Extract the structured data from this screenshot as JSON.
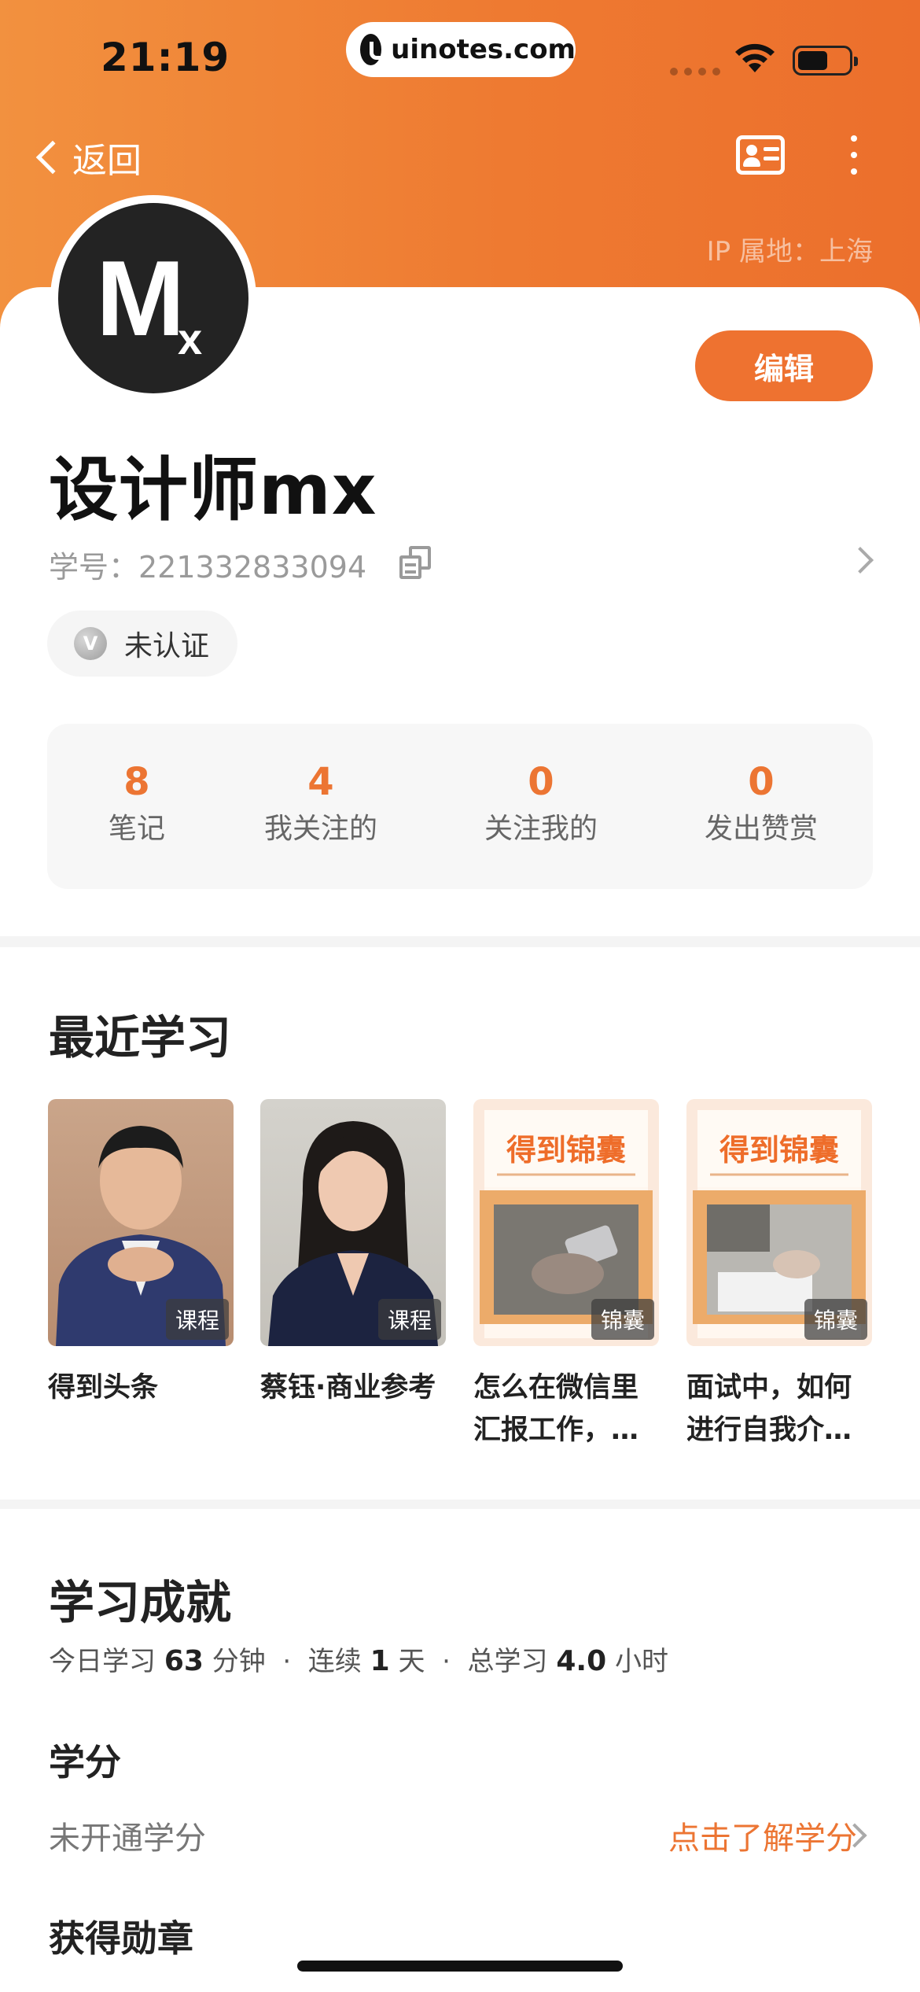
{
  "status_bar": {
    "time": "21:19",
    "url": "uinotes.com"
  },
  "nav": {
    "back_label": "返回",
    "ip_location": "IP 属地：上海"
  },
  "profile": {
    "avatar_letters": "M",
    "avatar_sub": "x",
    "edit_label": "编辑",
    "name": "设计师mx",
    "student_id": "学号：221332833094",
    "verify_icon": "V",
    "verify_label": "未认证"
  },
  "stats": [
    {
      "value": "8",
      "label": "笔记"
    },
    {
      "value": "4",
      "label": "我关注的"
    },
    {
      "value": "0",
      "label": "关注我的"
    },
    {
      "value": "0",
      "label": "发出赞赏"
    }
  ],
  "recent": {
    "title": "最近学习",
    "items": [
      {
        "title": "得到头条",
        "tag": "课程"
      },
      {
        "title": "蔡钰·商业参考",
        "tag": "课程"
      },
      {
        "title": "怎么在微信里汇报工作，…",
        "tag": "锦囊",
        "banner": "得到锦囊"
      },
      {
        "title": "面试中，如何进行自我介…",
        "tag": "锦囊",
        "banner": "得到锦囊"
      }
    ]
  },
  "achievement": {
    "title": "学习成就",
    "today_prefix": "今日学习",
    "today_value": "63",
    "today_unit": "分钟",
    "dot": "·",
    "streak_prefix": "连续",
    "streak_value": "1",
    "streak_unit": "天",
    "total_prefix": "总学习",
    "total_value": "4.0",
    "total_unit": "小时"
  },
  "credits": {
    "title": "学分",
    "status": "未开通学分",
    "link": "点击了解学分"
  },
  "medals": {
    "title": "获得勋章"
  },
  "colors": {
    "brand_orange": "#ee7230",
    "header_gradient_start": "#f2913f",
    "header_gradient_end": "#ec6f2c"
  },
  "icons": [
    "wifi-icon",
    "battery-icon",
    "back-chevron-icon",
    "id-card-icon",
    "more-icon",
    "copy-icon",
    "verify-icon",
    "chevron-right-icon"
  ]
}
